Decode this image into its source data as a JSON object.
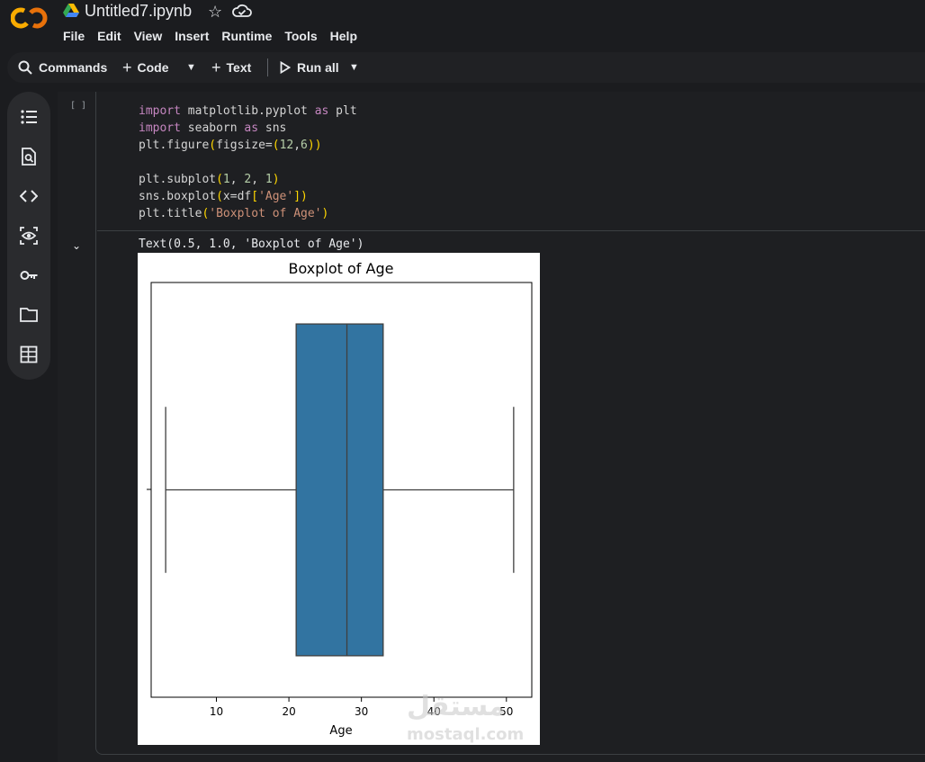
{
  "header": {
    "title": "Untitled7.ipynb",
    "logo_text": "CO"
  },
  "menu": [
    "File",
    "Edit",
    "View",
    "Insert",
    "Runtime",
    "Tools",
    "Help"
  ],
  "toolbar": {
    "commands": "Commands",
    "code": "Code",
    "text": "Text",
    "run_all": "Run all"
  },
  "sidebar_icons": [
    "toc-icon",
    "find-icon",
    "code-snippets-icon",
    "variables-icon",
    "secrets-icon",
    "files-icon",
    "data-table-icon"
  ],
  "cell": {
    "run_indicator": "[ ]",
    "code_lines": [
      "import matplotlib.pyplot as plt",
      "import seaborn as sns",
      "plt.figure(figsize=(12,6))",
      "",
      "plt.subplot(1, 2, 1)",
      "sns.boxplot(x=df['Age'])",
      "plt.title('Boxplot of Age')"
    ],
    "output_text": "Text(0.5, 1.0, 'Boxplot of Age')"
  },
  "chart_data": {
    "type": "boxplot",
    "title": "Boxplot of Age",
    "xlabel": "Age",
    "ylabel": "",
    "xlim": [
      1,
      53.5
    ],
    "xticks": [
      10,
      20,
      30,
      40,
      50
    ],
    "box": {
      "whisker_low": 3,
      "q1": 21,
      "median": 28,
      "q3": 33,
      "whisker_high": 51
    },
    "color": "#3274a1"
  },
  "watermark": {
    "arabic": "مستقل",
    "latin": "mostaql.com"
  }
}
